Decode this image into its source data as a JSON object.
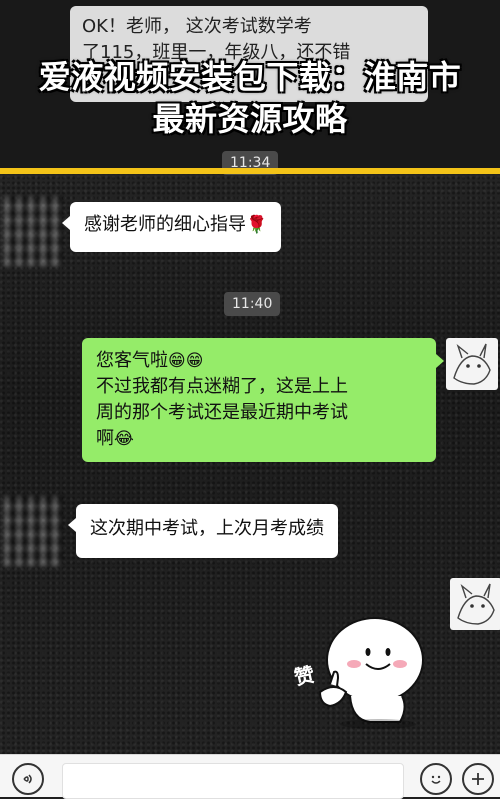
{
  "overlay_title": "爱液视频安装包下载：淮南市最新资源攻略",
  "messages": {
    "top_partial_line1": "OK！老师，    这次考试数学考",
    "top_partial_line2": "了115，班里一，年级八，还不错",
    "m1": "感谢老师的细心指导",
    "m1_emoji": "🌹",
    "m2_line1": "您客气啦",
    "m2_line1_emoji": "😁😁",
    "m2_line2": "不过我都有点迷糊了，这是上上",
    "m2_line3": "周的那个考试还是最近期中考试",
    "m2_line4": "啊",
    "m2_line4_emoji": "😂",
    "m3": "这次期中考试，上次月考成绩"
  },
  "timestamps": {
    "t1": "11:34",
    "t2": "11:40"
  },
  "sticker": {
    "label": "赞"
  },
  "input_bar": {
    "voice_icon": "voice-icon",
    "emoji_icon": "emoji-face-icon",
    "plus_icon": "plus-icon"
  }
}
